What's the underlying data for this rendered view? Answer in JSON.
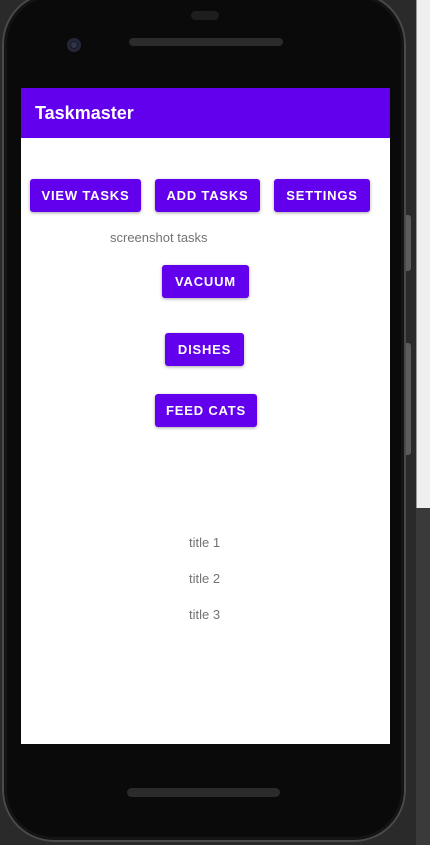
{
  "app": {
    "title": "Taskmaster"
  },
  "nav_buttons": {
    "view_tasks": "VIEW TASKS",
    "add_tasks": "ADD TASKS",
    "settings": "SETTINGS"
  },
  "screenshot_label": "screenshot tasks",
  "task_buttons": [
    "VACUUM",
    "DISHES",
    "FEED CATS"
  ],
  "task_titles": [
    "title 1",
    "title 2",
    "title 3"
  ],
  "colors": {
    "primary": "#6200ee",
    "on_primary": "#ffffff",
    "secondary_text": "#737373"
  }
}
